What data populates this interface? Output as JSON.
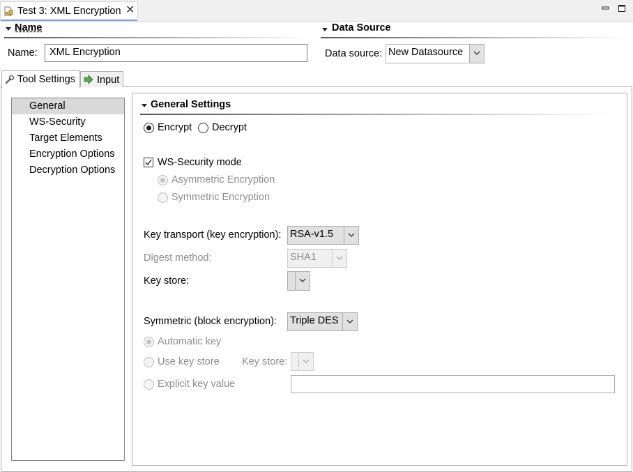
{
  "editor_tab": {
    "title": "Test 3: XML Encryption",
    "close_glyph": "✕"
  },
  "icons": {
    "tab_icon": "xml-file-icon",
    "minimize": "minimize-icon",
    "maximize": "maximize-icon",
    "tool_settings": "wrench-icon",
    "input": "input-arrow-icon"
  },
  "name_section": {
    "header": "Name",
    "label": "Name:",
    "value": "XML Encryption"
  },
  "datasource_section": {
    "header": "Data Source",
    "label": "Data source:",
    "value": "New Datasource"
  },
  "tabs": [
    {
      "label": "Tool Settings",
      "active": true
    },
    {
      "label": "Input",
      "active": false
    }
  ],
  "nav": {
    "items": [
      "General",
      "WS-Security",
      "Target Elements",
      "Encryption Options",
      "Decryption Options"
    ],
    "selected": "General"
  },
  "general_settings": {
    "header": "General Settings",
    "encrypt": "Encrypt",
    "decrypt": "Decrypt",
    "ws_security_mode": "WS-Security mode",
    "asymmetric": "Asymmetric Encryption",
    "symmetric_opt": "Symmetric Encryption",
    "key_transport_label": "Key transport (key encryption):",
    "key_transport_value": "RSA-v1.5",
    "digest_label": "Digest method:",
    "digest_value": "SHA1",
    "key_store_label": "Key store:",
    "key_store_value": "",
    "symmetric_label": "Symmetric (block encryption):",
    "symmetric_value": "Triple DES",
    "automatic_key": "Automatic key",
    "use_key_store": "Use key store",
    "key_store2_label": "Key store:",
    "explicit_key": "Explicit key value",
    "explicit_key_value": ""
  },
  "colors": {
    "tab_accent": "#7e9fd0",
    "selection": "#d9d9d9",
    "disabled_text": "#8c8c8c"
  }
}
